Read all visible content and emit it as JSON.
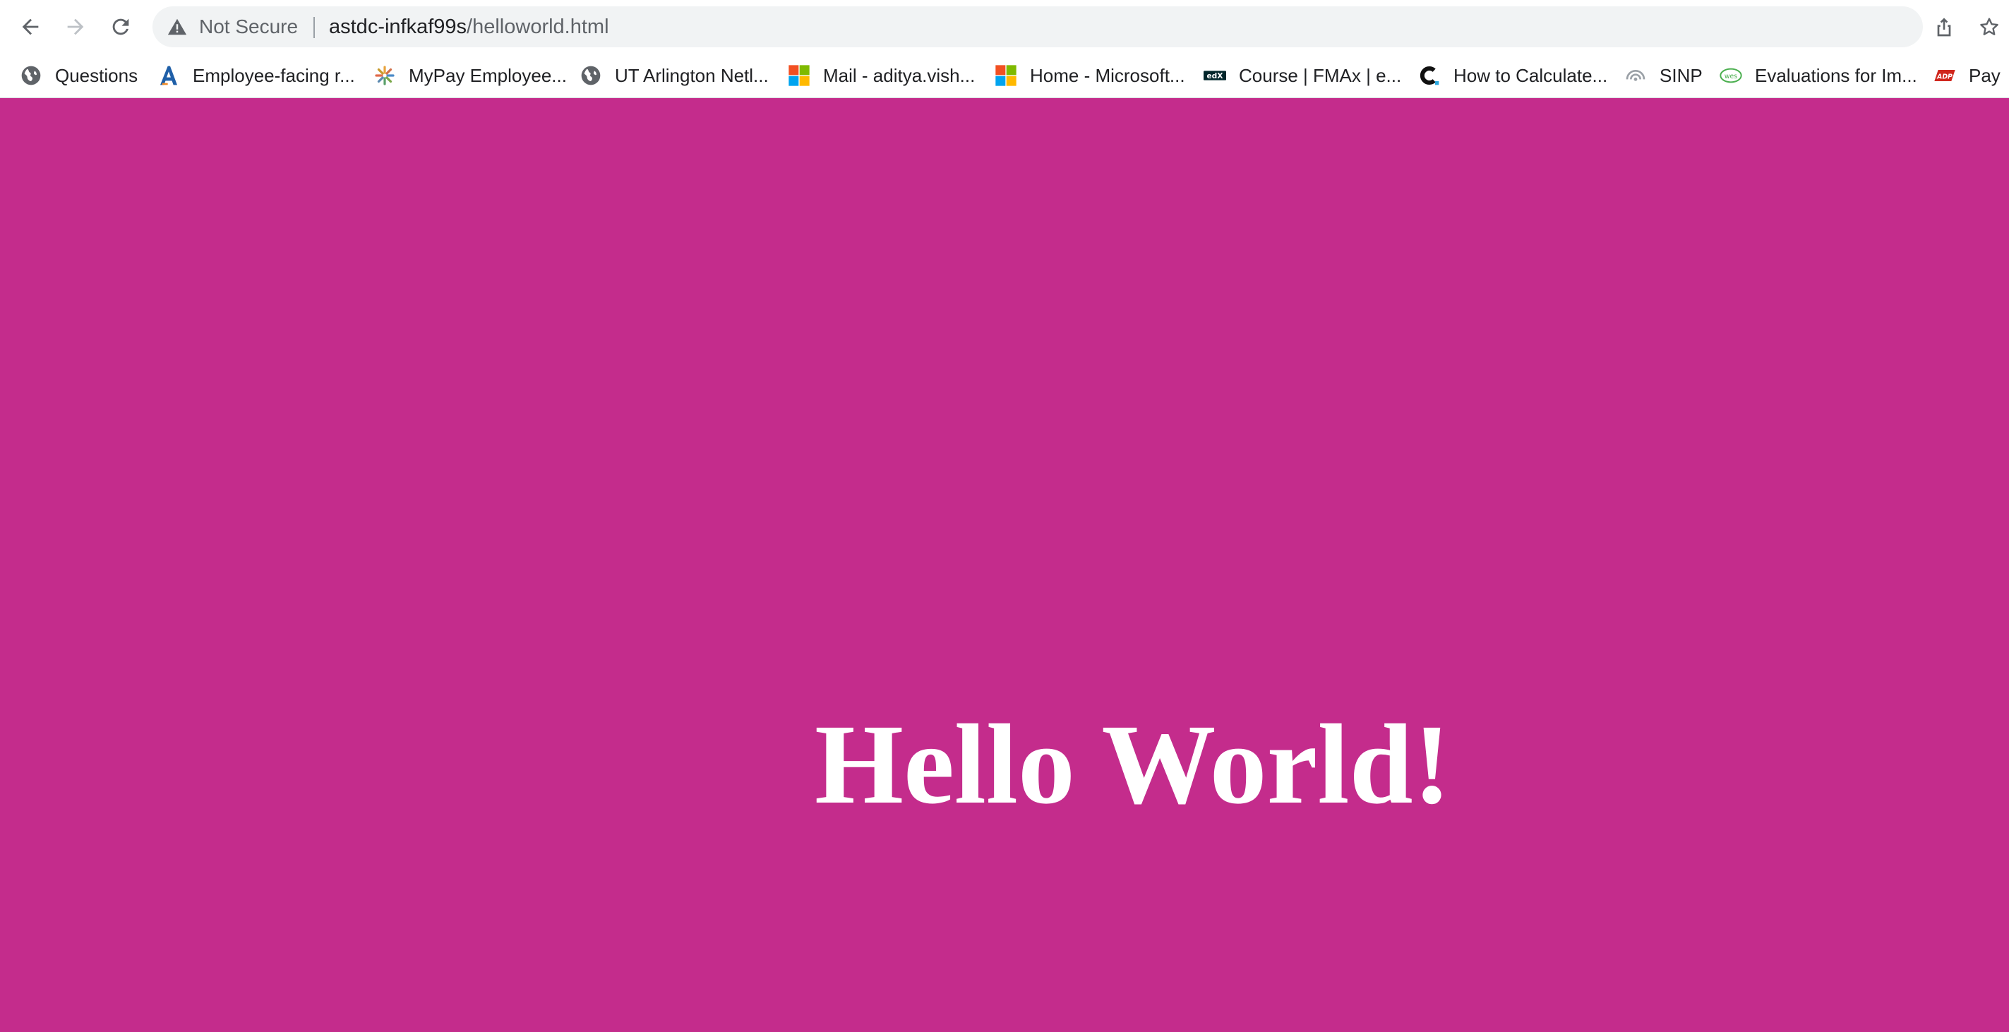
{
  "toolbar": {
    "security_label": "Not Secure",
    "url_host": "astdc-infkaf99s",
    "url_path": "/helloworld.html"
  },
  "bookmarks": [
    {
      "label": "Questions",
      "icon": "globe-icon"
    },
    {
      "label": "Employee-facing r...",
      "icon": "a-logo-icon"
    },
    {
      "label": "MyPay Employee...",
      "icon": "mypay-logo-icon"
    },
    {
      "label": "UT Arlington Netl...",
      "icon": "globe-icon"
    },
    {
      "label": "Mail - aditya.vish...",
      "icon": "microsoft-logo-icon"
    },
    {
      "label": "Home - Microsoft...",
      "icon": "microsoft-logo-icon"
    },
    {
      "label": "Course | FMAx | e...",
      "icon": "edx-logo-icon"
    },
    {
      "label": "How to Calculate...",
      "icon": "c-logo-icon"
    },
    {
      "label": "SINP",
      "icon": "sinp-logo-icon"
    },
    {
      "label": "Evaluations for Im...",
      "icon": "wes-logo-icon"
    },
    {
      "label": "Pay",
      "icon": "adp-logo-icon"
    }
  ],
  "page": {
    "heading": "Hello World!",
    "background_color": "#c42c8c",
    "text_color": "#ffffff"
  }
}
